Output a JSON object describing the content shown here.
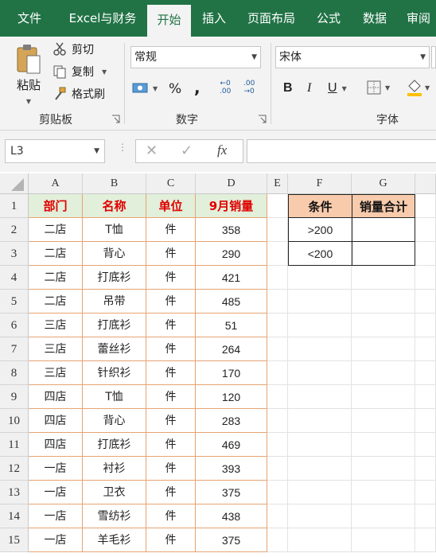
{
  "ribbon": {
    "tabs": [
      "文件",
      "Excel与财务",
      "开始",
      "插入",
      "页面布局",
      "公式",
      "数据",
      "审阅"
    ],
    "active_tab": "开始",
    "clipboard": {
      "paste": "粘贴",
      "cut": "剪切",
      "copy": "复制",
      "format_painter": "格式刷",
      "group_label": "剪贴板"
    },
    "number": {
      "format": "常规",
      "percent": "%",
      "comma": ",",
      "inc_decimal_top": "←0",
      "inc_decimal_bottom": ".00",
      "dec_decimal_top": ".00",
      "dec_decimal_bottom": "→0",
      "group_label": "数字"
    },
    "font": {
      "name": "宋体",
      "bold": "B",
      "italic": "I",
      "underline": "U",
      "group_label": "字体"
    }
  },
  "formula_bar": {
    "name_box": "L3",
    "fx": "fx",
    "cancel": "✕",
    "enter": "✓",
    "formula": ""
  },
  "columns": [
    "A",
    "B",
    "C",
    "D",
    "E",
    "F",
    "G"
  ],
  "rows": [
    "1",
    "2",
    "3",
    "4",
    "5",
    "6",
    "7",
    "8",
    "9",
    "10",
    "11",
    "12",
    "13",
    "14",
    "15"
  ],
  "table": {
    "headers": [
      "部门",
      "名称",
      "单位",
      "9月销量"
    ],
    "rows": [
      [
        "二店",
        "T恤",
        "件",
        "358"
      ],
      [
        "二店",
        "背心",
        "件",
        "290"
      ],
      [
        "二店",
        "打底衫",
        "件",
        "421"
      ],
      [
        "二店",
        "吊带",
        "件",
        "485"
      ],
      [
        "三店",
        "打底衫",
        "件",
        "51"
      ],
      [
        "三店",
        "蕾丝衫",
        "件",
        "264"
      ],
      [
        "三店",
        "针织衫",
        "件",
        "170"
      ],
      [
        "四店",
        "T恤",
        "件",
        "120"
      ],
      [
        "四店",
        "背心",
        "件",
        "283"
      ],
      [
        "四店",
        "打底衫",
        "件",
        "469"
      ],
      [
        "一店",
        "衬衫",
        "件",
        "393"
      ],
      [
        "一店",
        "卫衣",
        "件",
        "375"
      ],
      [
        "一店",
        "雪纺衫",
        "件",
        "438"
      ],
      [
        "一店",
        "羊毛衫",
        "件",
        "375"
      ]
    ]
  },
  "criteria": {
    "headers": [
      "条件",
      "销量合计"
    ],
    "rows": [
      [
        ">200",
        ""
      ],
      [
        "<200",
        ""
      ]
    ]
  },
  "colors": {
    "ribbon_green": "#217346",
    "header_fill": "#e2efda",
    "header_text": "#e00000",
    "criteria_fill": "#f8cbad",
    "table_border": "#e6a472"
  }
}
